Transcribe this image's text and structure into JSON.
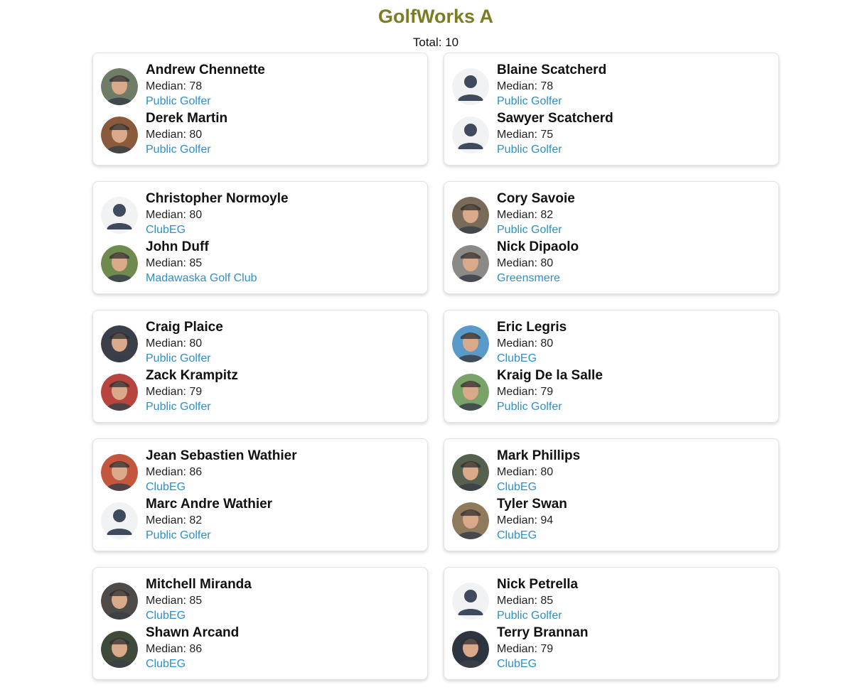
{
  "header": {
    "title": "GolfWorks A",
    "total": "Total: 10"
  },
  "teams": [
    {
      "players": [
        {
          "name": "Andrew Chennette",
          "median": "Median: 78",
          "club": "Public Golfer",
          "avatar": "photo",
          "tone": "#6f7c68"
        },
        {
          "name": "Derek Martin",
          "median": "Median: 80",
          "club": "Public Golfer",
          "avatar": "photo",
          "tone": "#8a5a3c"
        }
      ]
    },
    {
      "players": [
        {
          "name": "Blaine Scatcherd",
          "median": "Median: 78",
          "club": "Public Golfer",
          "avatar": "default-user-icon"
        },
        {
          "name": "Sawyer Scatcherd",
          "median": "Median: 75",
          "club": "Public Golfer",
          "avatar": "default-user-icon"
        }
      ]
    },
    {
      "players": [
        {
          "name": "Christopher Normoyle",
          "median": "Median: 80",
          "club": "ClubEG",
          "avatar": "default-user-icon"
        },
        {
          "name": "John Duff",
          "median": "Median: 85",
          "club": "Madawaska Golf Club",
          "avatar": "photo",
          "tone": "#6e8a4f"
        }
      ]
    },
    {
      "players": [
        {
          "name": "Cory Savoie",
          "median": "Median: 82",
          "club": "Public Golfer",
          "avatar": "photo",
          "tone": "#7a6a5a"
        },
        {
          "name": "Nick Dipaolo",
          "median": "Median: 80",
          "club": "Greensmere",
          "avatar": "photo",
          "tone": "#8c8a86"
        }
      ]
    },
    {
      "players": [
        {
          "name": "Craig Plaice",
          "median": "Median: 80",
          "club": "Public Golfer",
          "avatar": "photo",
          "tone": "#3a3f4a"
        },
        {
          "name": "Zack Krampitz",
          "median": "Median: 79",
          "club": "Public Golfer",
          "avatar": "photo",
          "tone": "#b8443f"
        }
      ]
    },
    {
      "players": [
        {
          "name": "Eric Legris",
          "median": "Median: 80",
          "club": "ClubEG",
          "avatar": "photo",
          "tone": "#5a9ac8"
        },
        {
          "name": "Kraig De la Salle",
          "median": "Median: 79",
          "club": "Public Golfer",
          "avatar": "photo",
          "tone": "#7aa36a"
        }
      ]
    },
    {
      "players": [
        {
          "name": "Jean Sebastien Wathier",
          "median": "Median: 86",
          "club": "ClubEG",
          "avatar": "photo",
          "tone": "#c4553e"
        },
        {
          "name": "Marc Andre Wathier",
          "median": "Median: 82",
          "club": "Public Golfer",
          "avatar": "default-user-icon"
        }
      ]
    },
    {
      "players": [
        {
          "name": "Mark Phillips",
          "median": "Median: 80",
          "club": "ClubEG",
          "avatar": "photo",
          "tone": "#55604f"
        },
        {
          "name": "Tyler Swan",
          "median": "Median: 94",
          "club": "ClubEG",
          "avatar": "photo",
          "tone": "#8f7a5e"
        }
      ]
    },
    {
      "players": [
        {
          "name": "Mitchell Miranda",
          "median": "Median: 85",
          "club": "ClubEG",
          "avatar": "photo",
          "tone": "#4d4a48"
        },
        {
          "name": "Shawn Arcand",
          "median": "Median: 86",
          "club": "ClubEG",
          "avatar": "photo",
          "tone": "#3e4a3a"
        }
      ]
    },
    {
      "players": [
        {
          "name": "Nick Petrella",
          "median": "Median: 85",
          "club": "Public Golfer",
          "avatar": "default-user-icon"
        },
        {
          "name": "Terry Brannan",
          "median": "Median: 79",
          "club": "ClubEG",
          "avatar": "photo",
          "tone": "#2d3540"
        }
      ]
    }
  ]
}
